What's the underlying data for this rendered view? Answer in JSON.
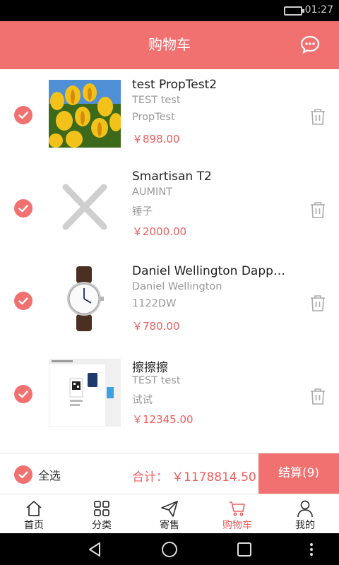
{
  "status_bar": {
    "time": "01:27"
  },
  "header": {
    "title": "购物车",
    "icon": "chat-bubble-icon"
  },
  "cart": {
    "items": [
      {
        "name": "test PropTest2",
        "brand": "TEST test",
        "spec": "PropTest",
        "price": "￥898.00",
        "checked": true,
        "image": "yellow-tulips"
      },
      {
        "name": "Smartisan T2",
        "brand": "AUMINT",
        "spec": "锤子",
        "price": "￥2000.00",
        "checked": true,
        "image": "placeholder-x"
      },
      {
        "name": "Daniel Wellington Dapper…",
        "brand": "Daniel Wellington",
        "spec": "1122DW",
        "price": "￥780.00",
        "checked": true,
        "image": "wristwatch"
      },
      {
        "name": "擦擦擦",
        "brand": "TEST test",
        "spec": "试试",
        "price": "￥12345.00",
        "checked": true,
        "image": "web-screenshot"
      }
    ]
  },
  "summary": {
    "select_all_label": "全选",
    "total_label": "合计：",
    "total_value": "￥1178814.50",
    "checkout_label": "结算(9)"
  },
  "tabs": [
    {
      "label": "首页",
      "icon": "home-icon",
      "active": false
    },
    {
      "label": "分类",
      "icon": "grid-icon",
      "active": false
    },
    {
      "label": "寄售",
      "icon": "send-icon",
      "active": false
    },
    {
      "label": "购物车",
      "icon": "cart-icon",
      "active": true
    },
    {
      "label": "我的",
      "icon": "person-icon",
      "active": false
    }
  ],
  "colors": {
    "accent": "#f17171",
    "price": "#f05e5e"
  }
}
